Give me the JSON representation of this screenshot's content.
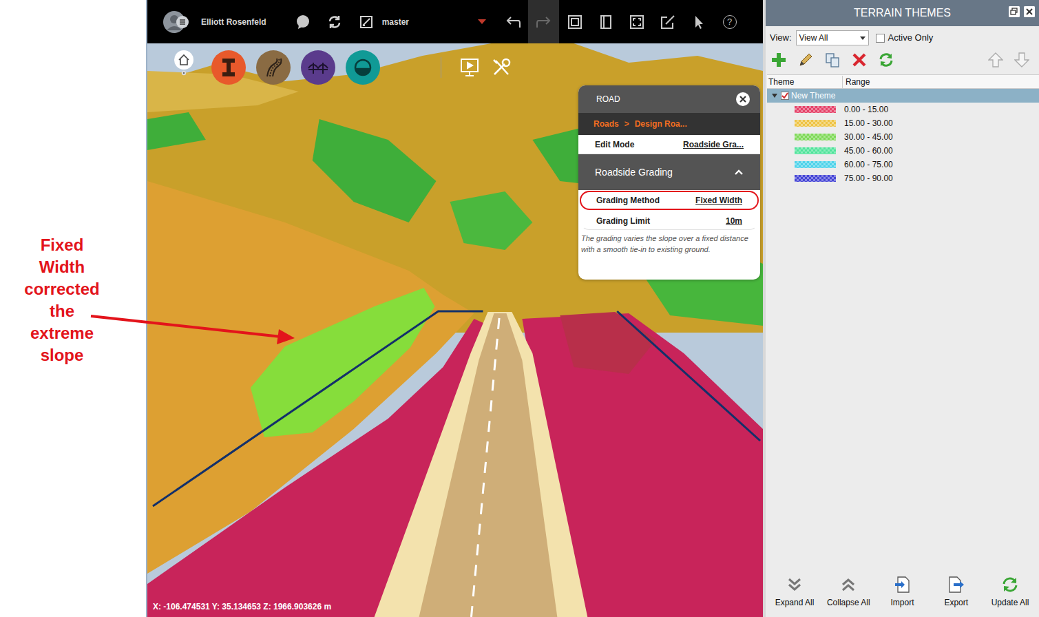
{
  "annotation": {
    "lines": [
      "Fixed",
      "Width",
      "corrected",
      "the",
      "extreme",
      "slope"
    ]
  },
  "toolbar": {
    "user": "Elliott Rosenfeld",
    "branch": "master",
    "help": "?"
  },
  "mode_buttons": [
    {
      "kind": "home",
      "color": "#ffffff"
    },
    {
      "kind": "infrastructure",
      "color": "#e8592b"
    },
    {
      "kind": "roads",
      "color": "#8a6b43"
    },
    {
      "kind": "bridges",
      "color": "#5a3b8c"
    },
    {
      "kind": "drainage",
      "color": "#109a96"
    }
  ],
  "road_panel": {
    "title": "ROAD",
    "breadcrumb": {
      "root": "Roads",
      "separator": ">",
      "current": "Design Roa..."
    },
    "edit_mode": {
      "label": "Edit Mode",
      "value": "Roadside Gra..."
    },
    "section": {
      "title": "Roadside Grading",
      "expanded": true
    },
    "properties": [
      {
        "label": "Grading Method",
        "value": "Fixed Width",
        "highlighted": true
      },
      {
        "label": "Grading Limit",
        "value": "10m",
        "highlighted": false
      }
    ],
    "description": "The grading varies the slope over a fixed distance with a smooth tie-in to existing ground."
  },
  "viewport": {
    "coordinates": "X: -106.474531 Y: 35.134653 Z: 1966.903626 m"
  },
  "themes_panel": {
    "title": "TERRAIN THEMES",
    "view": {
      "label": "View:",
      "value": "View All"
    },
    "active_only": {
      "label": "Active Only",
      "checked": false
    },
    "columns": [
      "Theme",
      "Range"
    ],
    "theme": {
      "name": "New Theme",
      "expanded": true,
      "checked": true,
      "selected": true
    },
    "ranges": [
      {
        "label": "0.00 - 15.00",
        "color": "#e5446a"
      },
      {
        "label": "15.00 - 30.00",
        "color": "#eec447"
      },
      {
        "label": "30.00 - 45.00",
        "color": "#7ed957"
      },
      {
        "label": "45.00 - 60.00",
        "color": "#4fe39a"
      },
      {
        "label": "60.00 - 75.00",
        "color": "#4fd3ea"
      },
      {
        "label": "75.00 - 90.00",
        "color": "#4747d6"
      }
    ],
    "footer_buttons": [
      "Expand All",
      "Collapse All",
      "Import",
      "Export",
      "Update All"
    ]
  }
}
